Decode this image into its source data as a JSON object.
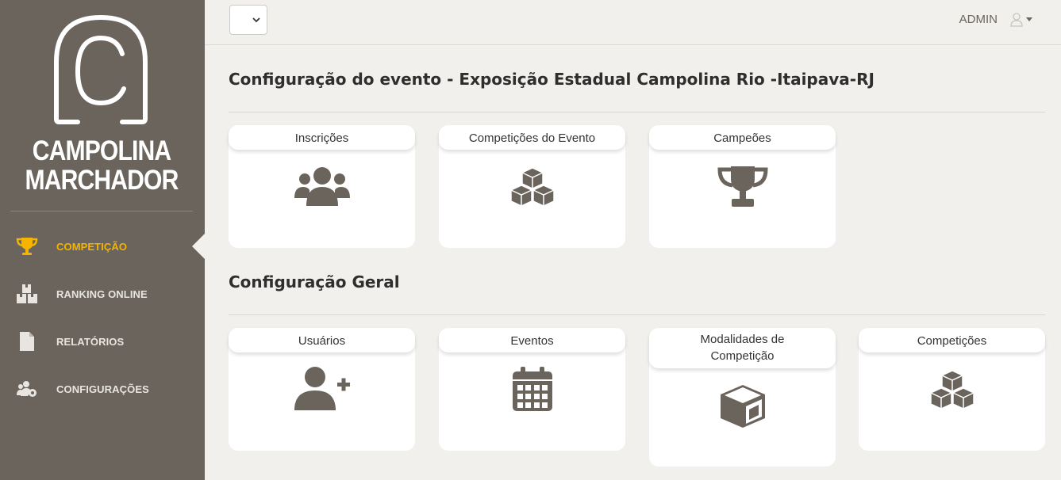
{
  "brand": {
    "line1": "CAMPOLINA",
    "line2": "MARCHADOR"
  },
  "sidebar": {
    "items": [
      {
        "label": "COMPETIÇÃO",
        "icon": "trophy-icon",
        "active": true
      },
      {
        "label": "RANKING ONLINE",
        "icon": "boxes-icon",
        "active": false
      },
      {
        "label": "RELATÓRIOS",
        "icon": "file-icon",
        "active": false
      },
      {
        "label": "CONFIGURAÇÕES",
        "icon": "users-cog-icon",
        "active": false
      }
    ]
  },
  "topbar": {
    "select_value": "",
    "user_name": "ADMIN",
    "user_icon": "user-icon"
  },
  "sections": [
    {
      "title": "Configuração do evento - Exposição Estadual Campolina Rio -Itaipava-RJ",
      "cards": [
        {
          "label": "Inscrições",
          "icon": "users-icon"
        },
        {
          "label": "Competições do Evento",
          "icon": "cubes-icon"
        },
        {
          "label": "Campeões",
          "icon": "trophy-icon"
        }
      ]
    },
    {
      "title": "Configuração Geral",
      "cards": [
        {
          "label": "Usuários",
          "icon": "user-plus-icon"
        },
        {
          "label": "Eventos",
          "icon": "calendar-icon"
        },
        {
          "label": "Modalidades de Competição",
          "icon": "cube-icon"
        },
        {
          "label": "Competições",
          "icon": "cubes-icon"
        }
      ]
    }
  ],
  "colors": {
    "sidebar": "#6a645c",
    "accent": "#f4b400",
    "background": "#f2f0ec",
    "icon": "#6a645c"
  }
}
